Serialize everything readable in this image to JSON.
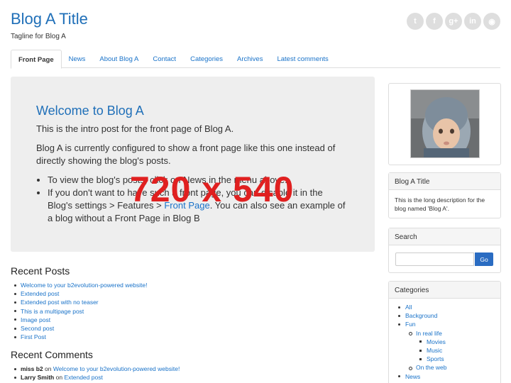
{
  "header": {
    "title": "Blog A Title",
    "tagline": "Tagline for Blog A"
  },
  "social": [
    {
      "icon": "twitter-icon",
      "glyph": "t"
    },
    {
      "icon": "facebook-icon",
      "glyph": "f"
    },
    {
      "icon": "google-plus-icon",
      "glyph": "g+"
    },
    {
      "icon": "linkedin-icon",
      "glyph": "in"
    },
    {
      "icon": "github-icon",
      "glyph": "◉"
    }
  ],
  "tabs": [
    "Front Page",
    "News",
    "About Blog A",
    "Contact",
    "Categories",
    "Archives",
    "Latest comments"
  ],
  "intro": {
    "heading": "Welcome to Blog A",
    "p1": "This is the intro post for the front page of Blog A.",
    "p2": "Blog A is currently configured to show a front page like this one instead of directly showing the blog's posts.",
    "bullet1": "To view the blog's posts, click on News in the menu above.",
    "bullet2_pre": "If you don't want to have such a front page, you can disable it in the Blog's settings > Features > ",
    "bullet2_link": "Front Page",
    "bullet2_post": ". You can also see an example of a blog without a Front Page in Blog B"
  },
  "watermark": "720 x 540",
  "recent_posts": {
    "title": "Recent Posts",
    "items": [
      "Welcome to your b2evolution-powered website!",
      "Extended post",
      "Extended post with no teaser",
      "This is a multipage post",
      "Image post",
      "Second post",
      "First Post"
    ]
  },
  "recent_comments": {
    "title": "Recent Comments",
    "items": [
      {
        "author": "miss b2",
        "on": "on",
        "post": "Welcome to your b2evolution-powered website!"
      },
      {
        "author": "Larry Smith",
        "on": "on",
        "post": "Extended post"
      }
    ]
  },
  "sidebar": {
    "about": {
      "title": "Blog A Title",
      "text": "This is the long description for the blog named 'Blog A'."
    },
    "search": {
      "title": "Search",
      "button": "Go",
      "placeholder": ""
    },
    "categories": {
      "title": "Categories",
      "items": [
        "All",
        "Background",
        "Fun"
      ],
      "fun_children": [
        "In real life"
      ],
      "real_life_children": [
        "Movies",
        "Music",
        "Sports"
      ],
      "fun_children_2": [
        "On the web"
      ],
      "last": [
        "News"
      ]
    }
  }
}
